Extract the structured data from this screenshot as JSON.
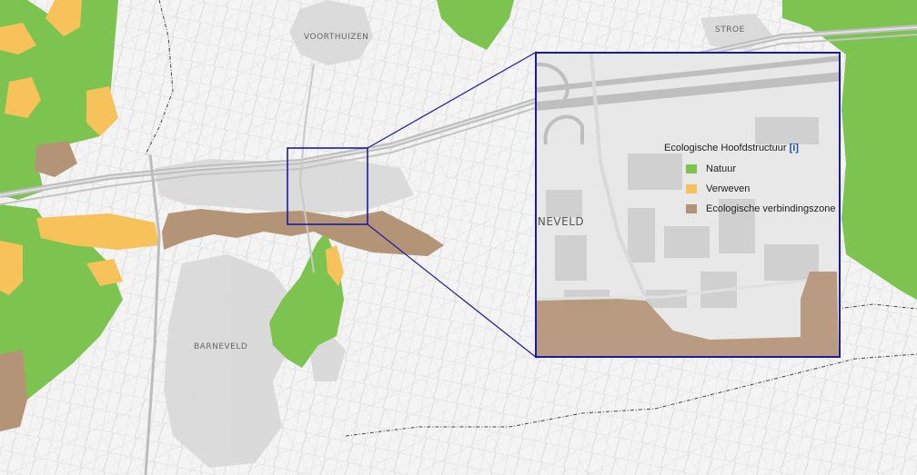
{
  "places": {
    "voorthuizen": "VOORTHUIZEN",
    "stroe": "STROE",
    "barneveld": "BARNEVELD",
    "barneveld_inset": "RNEVELD"
  },
  "legend": {
    "title": "Ecologische Hoofdstructuur",
    "info": "[i]",
    "items": [
      {
        "label": "Natuur",
        "color": "#7cc44f"
      },
      {
        "label": "Verweven",
        "color": "#f7c25a"
      },
      {
        "label": "Ecologische verbindingszone",
        "color": "#b39477"
      }
    ]
  },
  "colors": {
    "natuur": "#7cc44f",
    "verweven": "#f7c25a",
    "verbindingszone": "#b39477",
    "highlight_box": "#1a1aa6",
    "urban": "#d9d9d9",
    "background": "#f3f3f3"
  }
}
